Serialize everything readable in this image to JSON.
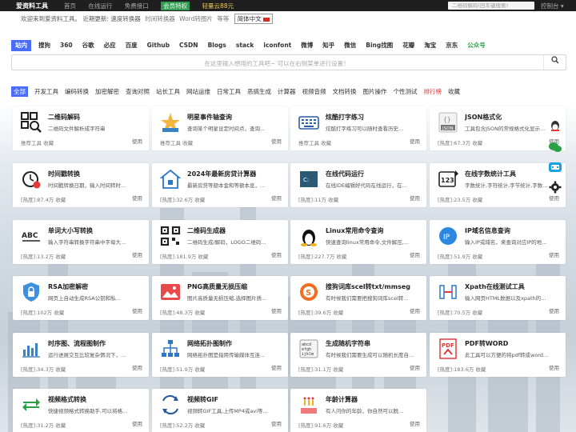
{
  "topbar": {
    "logo": "爱资料工具",
    "nav": [
      "首页",
      "在线运行",
      "免费接口"
    ],
    "nav_green": "会员特权",
    "nav_yellow": "轻量云88元",
    "search_placeholder": "二维码解码(回车键搜索)",
    "control": "控制台"
  },
  "subline": {
    "welcome": "欢迎来到爱资料工具。",
    "updates": "近期更新: 速度转换器",
    "more": "时间转换器",
    "more2": "Word转图片",
    "etc": "等等",
    "lang": "简体中文"
  },
  "search_tabs": [
    "站内",
    "搜狗",
    "360",
    "谷歌",
    "必应",
    "百度",
    "Github",
    "CSDN",
    "Blogs",
    "stack",
    "iconfont",
    "微博",
    "知乎",
    "微信",
    "Bing找图",
    "花瓣",
    "淘宝",
    "京东",
    "公众号"
  ],
  "search": {
    "placeholder": "在这里输入想用的工具吧~ 可以在右侧菜单进行设置！",
    "icon": "search-icon"
  },
  "categories": [
    "全部",
    "开发工具",
    "编码转换",
    "加密解密",
    "查询对照",
    "站长工具",
    "网站运维",
    "日常工具",
    "恶搞生成",
    "计算器",
    "视频音频",
    "文档转换",
    "图片操作",
    "个性测试",
    "排行榜",
    "收藏"
  ],
  "use_label": "使用",
  "fav_label": "收藏",
  "cards": [
    {
      "title": "二维码解码",
      "desc": "二维码文件解析成字符串",
      "meta": "推荐工具 收藏",
      "icon": "qrcode-scan-icon"
    },
    {
      "title": "明星事件轴查询",
      "desc": "查询某个明星设定时间点，查询...",
      "meta": "推荐工具 收藏",
      "icon": "star-icon"
    },
    {
      "title": "炫酷打字练习",
      "desc": "炫酷打字练习可以随时查看历史...",
      "meta": "推荐工具 收藏",
      "icon": "keyboard-icon"
    },
    {
      "title": "JSON格式化",
      "desc": "工具包含JSON的常规格式化显示...",
      "meta": "[热度]:67.3万 收藏",
      "icon": "json-icon"
    },
    {
      "title": "时间戳转换",
      "desc": "时间戳转换日期，输入时间转时...",
      "meta": "[热度]:87.4万 收藏",
      "icon": "clock-icon"
    },
    {
      "title": "2024年最新房贷计算器",
      "desc": "最新房贷等额本金和等额本息，...",
      "meta": "[热度]:32.6万 收藏",
      "icon": "house-icon"
    },
    {
      "title": "在线代码运行",
      "desc": "在线IDE编辑好代码在线运行，在...",
      "meta": "[热度]:11万 收藏",
      "icon": "code-icon"
    },
    {
      "title": "在线字数统计工具",
      "desc": "字数统计,字符统计,字节统计,字数...",
      "meta": "[热度]:23.5万 收藏",
      "icon": "count-icon"
    },
    {
      "title": "单词大小写转换",
      "desc": "输入字符串转换字符串中字母大...",
      "meta": "[热度]:13.2万 收藏",
      "icon": "abc-icon"
    },
    {
      "title": "二维码生成器",
      "desc": "二维码生成/解码，LOGO二维码...",
      "meta": "[热度]:181.9万 收藏",
      "icon": "qrcode-icon"
    },
    {
      "title": "Linux常用命令查询",
      "desc": "快速查询linux常用命令,文件解压,...",
      "meta": "[热度]:227.7万 收藏",
      "icon": "linux-icon"
    },
    {
      "title": "IP域名信息查询",
      "desc": "输入IP或域名，来查询对应IP的地...",
      "meta": "[热度]:51.9万 收藏",
      "icon": "ip-icon"
    },
    {
      "title": "RSA加密解密",
      "desc": "网页上自动生成RSA公钥和私...",
      "meta": "[热度]:102万 收藏",
      "icon": "shield-icon"
    },
    {
      "title": "PNG高质量无损压缩",
      "desc": "图片高质量无损压缩,选择图片质...",
      "meta": "[热度]:48.3万 收藏",
      "icon": "image-icon"
    },
    {
      "title": "搜狗词库scel转txt/mmseg",
      "desc": "有时候我们需要把搜狗词库scel转...",
      "meta": "[热度]:39.6万 收藏",
      "icon": "sogou-icon"
    },
    {
      "title": "Xpath在线测试工具",
      "desc": "输入网页HTML数据以及xpath的...",
      "meta": "[热度]:70.5万 收藏",
      "icon": "xpath-icon"
    },
    {
      "title": "时序图、流程图制作",
      "desc": "运行进展交互比较复杂情况下，...",
      "meta": "[热度]:34.3万 收藏",
      "icon": "chart-icon"
    },
    {
      "title": "网络拓扑图制作",
      "desc": "网络拓扑图是指用传输媒体互连...",
      "meta": "[热度]:51.9万 收藏",
      "icon": "topology-icon"
    },
    {
      "title": "生成随机字符串",
      "desc": "有时候我们需要生成可以随机长度自...",
      "meta": "[热度]:31.1万 收藏",
      "icon": "random-text-icon"
    },
    {
      "title": "PDF转WORD",
      "desc": "此工具可以方便的将pdf转成word...",
      "meta": "[热度]:183.6万 收藏",
      "icon": "pdf-icon"
    },
    {
      "title": "视频格式转换",
      "desc": "快捷视频格式转换助手,可以将格...",
      "meta": "[热度]:31.2万 收藏",
      "icon": "convert-icon"
    },
    {
      "title": "视频转GIF",
      "desc": "视频转GIF工具,上传MP4或avi等...",
      "meta": "[热度]:52.2万 收藏",
      "icon": "gif-icon"
    },
    {
      "title": "年龄计算器",
      "desc": "有人问你的年龄，你自然可以脱...",
      "meta": "[热度]:91.6万 收藏",
      "icon": "cake-icon"
    }
  ],
  "side": [
    "qq-icon",
    "wechat-icon",
    "bilibili-icon",
    "settings-icon"
  ]
}
